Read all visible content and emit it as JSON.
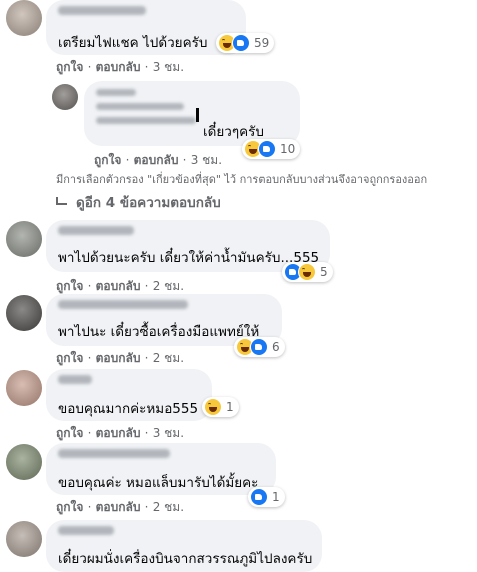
{
  "actions": {
    "like": "ถูกใจ",
    "reply": "ตอบกลับ",
    "sep": "·"
  },
  "comments": [
    {
      "text": "เตรียมไฟแชค ไปด้วยครับ",
      "time": "3 ชม.",
      "reactions": [
        "haha",
        "like"
      ],
      "count": "59"
    },
    {
      "text": "เดี๋ยวๆครับ",
      "time": "3 ชม.",
      "reactions": [
        "haha",
        "like"
      ],
      "count": "10"
    },
    {
      "text": "พาไปด้วยนะครับ เดี๋ยวให้ค่าน้ำมันครับ...555",
      "time": "2 ชม.",
      "reactions": [
        "like",
        "haha"
      ],
      "count": "5"
    },
    {
      "text": "พาไปนะ เดี๋ยวซื้อเครื่องมือแพทย์ให้",
      "time": "2 ชม.",
      "reactions": [
        "haha",
        "like"
      ],
      "count": "6"
    },
    {
      "text": "ขอบคุณมากค่ะหมอ555",
      "time": "3 ชม.",
      "reactions": [
        "haha"
      ],
      "count": "1"
    },
    {
      "text": "ขอบคุณค่ะ หมอแล็บมารับได้มั้ยคะ",
      "time": "2 ชม.",
      "reactions": [
        "like"
      ],
      "count": "1"
    },
    {
      "text": "เดี๋ยวผมนั่งเครื่องบินจากสวรรณภูมิไปลงครับ",
      "time": "",
      "reactions": [],
      "count": ""
    }
  ],
  "filter_note": "มีการเลือกตัวกรอง \"เกี่ยวข้องที่สุด\" ไว้ การตอบกลับบางส่วนจึงอาจถูกกรองออก",
  "more_replies": "ดูอีก 4 ข้อความตอบกลับ"
}
